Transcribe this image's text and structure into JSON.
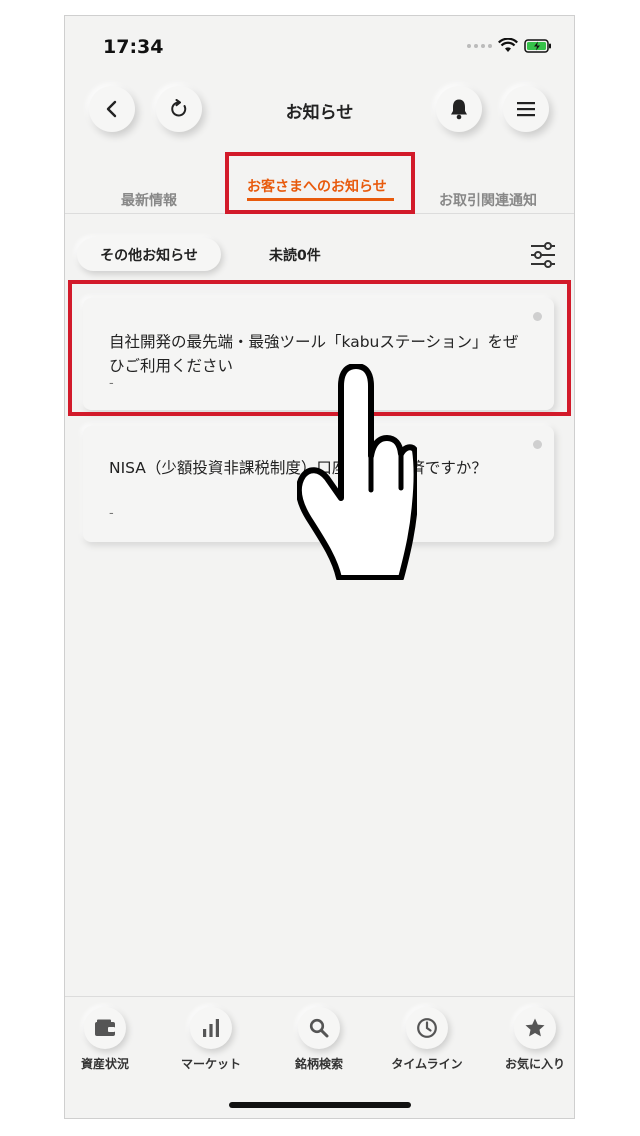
{
  "status_bar": {
    "time": "17:34"
  },
  "header": {
    "title": "お知らせ",
    "back_icon": "chevron-left-icon",
    "refresh_icon": "refresh-icon",
    "bell_icon": "bell-icon",
    "menu_icon": "hamburger-icon"
  },
  "tabs": [
    {
      "label": "最新情報",
      "active": false
    },
    {
      "label": "お客さまへのお知らせ",
      "active": true
    },
    {
      "label": "お取引関連通知",
      "active": false
    }
  ],
  "filter_row": {
    "pill_label": "その他お知らせ",
    "unread_label": "未読0件",
    "filter_icon": "sliders-icon"
  },
  "notices": [
    {
      "title": "自社開発の最先端・最強ツール「kabuステーション」をぜひご利用ください",
      "date": "-"
    },
    {
      "title": "NISA（少額投資非課税制度）口座開設はお済ですか？",
      "date": "-"
    }
  ],
  "bottom_nav": [
    {
      "label": "資産状況",
      "icon": "wallet-icon"
    },
    {
      "label": "マーケット",
      "icon": "bar-chart-icon"
    },
    {
      "label": "銘柄検索",
      "icon": "search-icon"
    },
    {
      "label": "タイムライン",
      "icon": "clock-icon"
    },
    {
      "label": "お気に入り",
      "icon": "star-icon"
    }
  ],
  "colors": {
    "accent": "#e85a0c",
    "highlight_frame": "#d21a2a",
    "background": "#f3f3f2"
  }
}
